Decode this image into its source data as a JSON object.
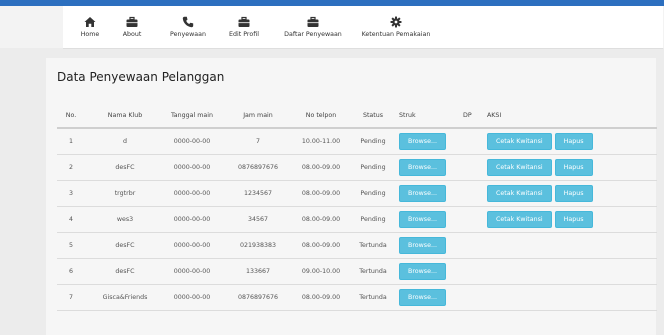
{
  "nav": {
    "items": [
      {
        "label": "Home",
        "icon": "home-icon"
      },
      {
        "label": "About",
        "icon": "briefcase-icon"
      },
      {
        "label": "Penyewaan",
        "icon": "phone-icon"
      },
      {
        "label": "Edit Profil",
        "icon": "briefcase-icon"
      },
      {
        "label": "Daftar Penyewaan",
        "icon": "briefcase-icon"
      },
      {
        "label": "Ketentuan Pemakaian",
        "icon": "gear-icon"
      }
    ]
  },
  "page": {
    "title": "Data Penyewaan Pelanggan"
  },
  "table": {
    "headers": {
      "no": "No.",
      "klub": "Nama Klub",
      "tgl": "Tanggal main",
      "jam": "Jam main",
      "telp": "No telpon",
      "status": "Status",
      "struk": "Struk",
      "dp": "DP",
      "aksi": "AKSI"
    },
    "browse_label": "Browse...",
    "cetak_label": "Cetak Kwitansi",
    "hapus_label": "Hapus",
    "rows": [
      {
        "no": "1",
        "klub": "d",
        "tgl": "0000-00-00",
        "jam": "7",
        "telp": "10.00-11.00",
        "status": "Pending",
        "dp": "",
        "actions": true
      },
      {
        "no": "2",
        "klub": "desFC",
        "tgl": "0000-00-00",
        "jam": "0876897676",
        "telp": "08.00-09.00",
        "status": "Pending",
        "dp": "",
        "actions": true
      },
      {
        "no": "3",
        "klub": "trgtrbr",
        "tgl": "0000-00-00",
        "jam": "1234567",
        "telp": "08.00-09.00",
        "status": "Pending",
        "dp": "",
        "actions": true
      },
      {
        "no": "4",
        "klub": "wes3",
        "tgl": "0000-00-00",
        "jam": "34567",
        "telp": "08.00-09.00",
        "status": "Pending",
        "dp": "",
        "actions": true
      },
      {
        "no": "5",
        "klub": "desFC",
        "tgl": "0000-00-00",
        "jam": "021938383",
        "telp": "08.00-09.00",
        "status": "Tertunda",
        "dp": "",
        "actions": false
      },
      {
        "no": "6",
        "klub": "desFC",
        "tgl": "0000-00-00",
        "jam": "133667",
        "telp": "09.00-10.00",
        "status": "Tertunda",
        "dp": "",
        "actions": false
      },
      {
        "no": "7",
        "klub": "Gisca&Friends",
        "tgl": "0000-00-00",
        "jam": "0876897676",
        "telp": "08.00-09.00",
        "status": "Tertunda",
        "dp": "",
        "actions": false
      }
    ]
  },
  "colors": {
    "accent_bar": "#2c6fbf",
    "button_info": "#5bc0de"
  }
}
